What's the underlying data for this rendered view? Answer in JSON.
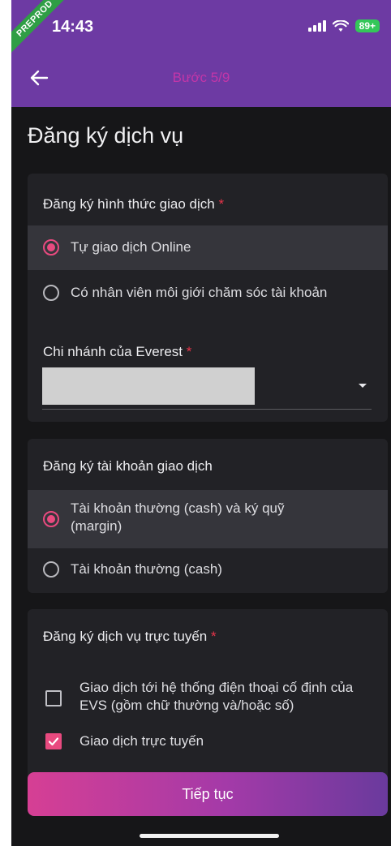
{
  "status_bar": {
    "time": "14:43",
    "ribbon": "PREPROD",
    "battery": "89+"
  },
  "app_bar": {
    "step": "Bước 5/9"
  },
  "page": {
    "title": "Đăng ký dịch vụ"
  },
  "trading_method": {
    "title": "Đăng ký hình thức giao dịch",
    "required_mark": "*",
    "options": [
      {
        "label": "Tự giao dịch Online",
        "selected": true
      },
      {
        "label": "Có nhân viên môi giới chăm sóc tài khoản",
        "selected": false
      }
    ],
    "branch_label": "Chi nhánh của Everest",
    "branch_required_mark": "*"
  },
  "trading_account": {
    "title": "Đăng ký tài khoản giao dịch",
    "options": [
      {
        "label": "Tài khoản thường (cash) và ký quỹ (margin)",
        "selected": true
      },
      {
        "label": "Tài khoản thường (cash)",
        "selected": false
      }
    ]
  },
  "online_services": {
    "title": "Đăng ký dịch vụ trực tuyến",
    "required_mark": "*",
    "options": [
      {
        "label": "Giao dịch tới hệ thống điện thoại cố định của EVS (gồm chữ thường và/hoặc số)",
        "checked": false
      },
      {
        "label": "Giao dịch trực tuyến",
        "checked": true
      }
    ]
  },
  "actions": {
    "continue_label": "Tiếp tục"
  },
  "colors": {
    "header": "#6d3aa3",
    "background": "#161618",
    "card": "#222226",
    "accent": "#e84a7f",
    "step_title": "#c236a8",
    "required": "#e8344a"
  }
}
